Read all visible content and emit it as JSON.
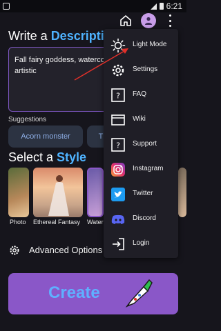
{
  "status_bar": {
    "time": "6:21"
  },
  "header": {
    "avatar_icon": "person-icon",
    "home_icon": "home-icon",
    "menu_icon": "more-vert-icon"
  },
  "write": {
    "prefix": "Write a ",
    "accent": "Description"
  },
  "prompt": {
    "text": "Fall fairy goddess, watercol painterly, textural, artistic"
  },
  "suggestions": {
    "label": "Suggestions",
    "items": [
      "Acorn monster",
      "T"
    ]
  },
  "style_section": {
    "prefix": "Select a ",
    "accent": "Style"
  },
  "styles": [
    {
      "label": "Photo"
    },
    {
      "label": "Ethereal Fantasy"
    },
    {
      "label": "Water"
    }
  ],
  "advanced": {
    "label": "Advanced Options"
  },
  "create": {
    "label": "Create"
  },
  "menu": {
    "items": [
      {
        "label": "Light Mode",
        "icon": "sun-icon"
      },
      {
        "label": "Settings",
        "icon": "gear-icon"
      },
      {
        "label": "FAQ",
        "icon": "faq-icon"
      },
      {
        "label": "Wiki",
        "icon": "wiki-icon"
      },
      {
        "label": "Support",
        "icon": "help-icon"
      },
      {
        "label": "Instagram",
        "icon": "instagram-icon"
      },
      {
        "label": "Twitter",
        "icon": "twitter-icon"
      },
      {
        "label": "Discord",
        "icon": "discord-icon"
      },
      {
        "label": "Login",
        "icon": "login-icon"
      }
    ]
  },
  "colors": {
    "accent_blue": "#4fb3ff",
    "create_purple": "#8a57c8",
    "border_purple": "#7e57c2",
    "annotation_red": "#e0302a"
  }
}
